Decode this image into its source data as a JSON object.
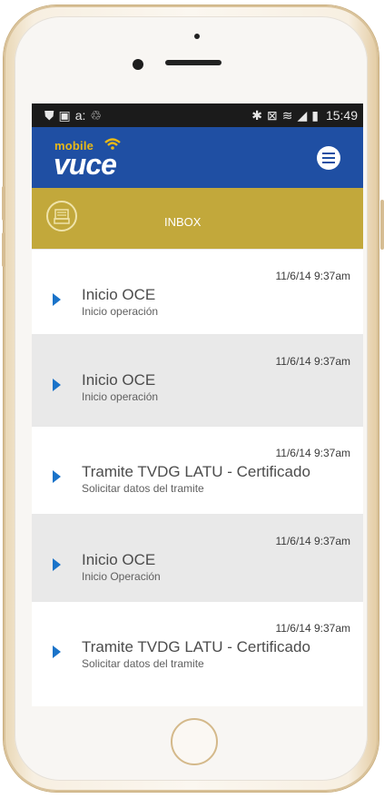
{
  "statusbar": {
    "icons_left": [
      "shield-icon",
      "image-icon",
      "signal-a-icon",
      "sync-icon"
    ],
    "icons_right": [
      "bluetooth-icon",
      "no-sim-icon",
      "wifi-icon",
      "signal-icon",
      "battery-icon"
    ],
    "time": "15:49"
  },
  "appbar": {
    "logo_small": "mobile",
    "logo_main": "vuce",
    "brand_color": "#1f4fa3",
    "accent_color": "#e9b916"
  },
  "inbox": {
    "label": "INBOX",
    "color": "#c2a83b"
  },
  "messages": [
    {
      "timestamp": "11/6/14 9:37am",
      "title": "Inicio OCE",
      "subtitle": "Inicio operación"
    },
    {
      "timestamp": "11/6/14 9:37am",
      "title": "Inicio OCE",
      "subtitle": "Inicio operación"
    },
    {
      "timestamp": "11/6/14 9:37am",
      "title": "Tramite TVDG LATU - Certificado",
      "subtitle": "Solicitar datos del tramite"
    },
    {
      "timestamp": "11/6/14 9:37am",
      "title": "Inicio OCE",
      "subtitle": "Inicio Operación"
    },
    {
      "timestamp": "11/6/14 9:37am",
      "title": "Tramite TVDG LATU - Certificado",
      "subtitle": "Solicitar datos del tramite"
    }
  ]
}
